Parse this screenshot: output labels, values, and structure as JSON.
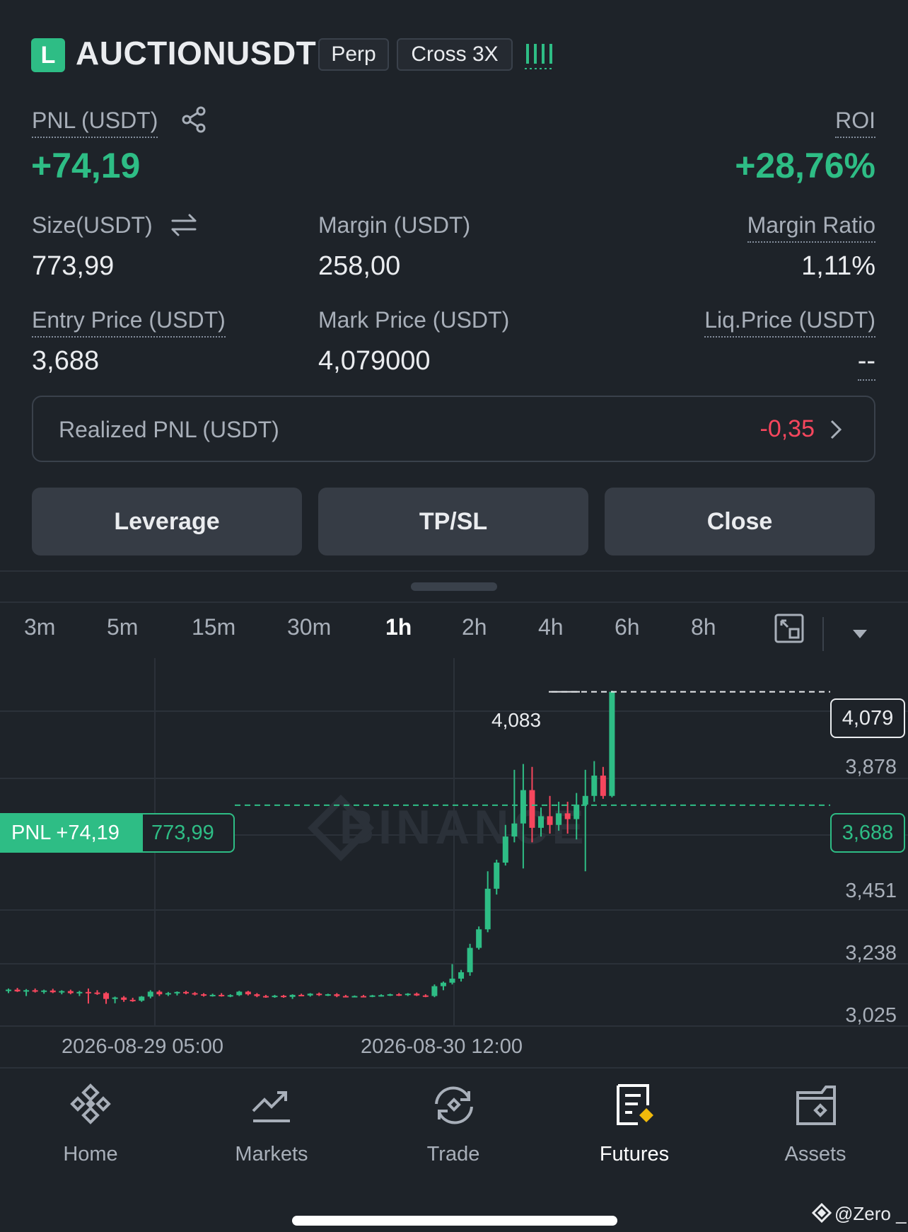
{
  "header": {
    "badge": "L",
    "symbol": "AUCTIONUSDT",
    "type_chip": "Perp",
    "margin_chip": "Cross 3X",
    "signal_icon": "signal-bars-icon"
  },
  "pnl": {
    "label": "PNL (USDT)",
    "value": "+74,19",
    "roi_label": "ROI",
    "roi_value": "+28,76%"
  },
  "stats": {
    "size_label": "Size(USDT)",
    "size_value": "773,99",
    "margin_label": "Margin (USDT)",
    "margin_value": "258,00",
    "ratio_label": "Margin Ratio",
    "ratio_value": "1,11%",
    "entry_label": "Entry Price (USDT)",
    "entry_value": "3,688",
    "mark_label": "Mark Price (USDT)",
    "mark_value": "4,079000",
    "liq_label": "Liq.Price (USDT)",
    "liq_value": "--"
  },
  "realized": {
    "label": "Realized PNL (USDT)",
    "value": "-0,35"
  },
  "actions": {
    "leverage": "Leverage",
    "tpsl": "TP/SL",
    "close": "Close"
  },
  "timeframes": [
    "3m",
    "5m",
    "15m",
    "30m",
    "1h",
    "2h",
    "4h",
    "6h",
    "8h"
  ],
  "active_timeframe": "1h",
  "chart": {
    "watermark": "BINANCE",
    "high_label": "4,083",
    "current_price": "4,079",
    "entry_price": "3,688",
    "pnl_tag": "PNL +74,19",
    "size_tag": "773,99",
    "y_ticks": [
      "3,878",
      "3,451",
      "3,238",
      "3,025"
    ],
    "x_ticks": [
      "2026-08-29 05:00",
      "2026-08-30 12:00"
    ]
  },
  "nav": {
    "home": "Home",
    "markets": "Markets",
    "trade": "Trade",
    "futures": "Futures",
    "assets": "Assets"
  },
  "credit": "@Zero _",
  "colors": {
    "up": "#2ebd85",
    "down": "#f6465d",
    "bg": "#1e2329"
  },
  "chart_data": {
    "type": "candlestick",
    "interval": "1h",
    "candles": [
      {
        "o": 3048,
        "h": 3056,
        "l": 3040,
        "c": 3052
      },
      {
        "o": 3052,
        "h": 3058,
        "l": 3044,
        "c": 3046
      },
      {
        "o": 3046,
        "h": 3054,
        "l": 3030,
        "c": 3050
      },
      {
        "o": 3050,
        "h": 3056,
        "l": 3042,
        "c": 3045
      },
      {
        "o": 3045,
        "h": 3052,
        "l": 3038,
        "c": 3049
      },
      {
        "o": 3049,
        "h": 3055,
        "l": 3040,
        "c": 3043
      },
      {
        "o": 3043,
        "h": 3050,
        "l": 3036,
        "c": 3047
      },
      {
        "o": 3047,
        "h": 3052,
        "l": 3036,
        "c": 3040
      },
      {
        "o": 3040,
        "h": 3048,
        "l": 3030,
        "c": 3044
      },
      {
        "o": 3044,
        "h": 3056,
        "l": 3004,
        "c": 3042
      },
      {
        "o": 3042,
        "h": 3050,
        "l": 3034,
        "c": 3038
      },
      {
        "o": 3040,
        "h": 3044,
        "l": 3003,
        "c": 3020
      },
      {
        "o": 3020,
        "h": 3028,
        "l": 3005,
        "c": 3025
      },
      {
        "o": 3025,
        "h": 3030,
        "l": 3010,
        "c": 3017
      },
      {
        "o": 3017,
        "h": 3024,
        "l": 3010,
        "c": 3014
      },
      {
        "o": 3014,
        "h": 3030,
        "l": 3010,
        "c": 3028
      },
      {
        "o": 3028,
        "h": 3050,
        "l": 3022,
        "c": 3045
      },
      {
        "o": 3045,
        "h": 3050,
        "l": 3030,
        "c": 3036
      },
      {
        "o": 3036,
        "h": 3044,
        "l": 3030,
        "c": 3040
      },
      {
        "o": 3040,
        "h": 3046,
        "l": 3032,
        "c": 3044
      },
      {
        "o": 3044,
        "h": 3048,
        "l": 3036,
        "c": 3040
      },
      {
        "o": 3040,
        "h": 3044,
        "l": 3032,
        "c": 3036
      },
      {
        "o": 3036,
        "h": 3040,
        "l": 3028,
        "c": 3032
      },
      {
        "o": 3032,
        "h": 3038,
        "l": 3028,
        "c": 3034
      },
      {
        "o": 3034,
        "h": 3040,
        "l": 3028,
        "c": 3030
      },
      {
        "o": 3030,
        "h": 3036,
        "l": 3026,
        "c": 3033
      },
      {
        "o": 3033,
        "h": 3048,
        "l": 3030,
        "c": 3045
      },
      {
        "o": 3045,
        "h": 3048,
        "l": 3032,
        "c": 3036
      },
      {
        "o": 3036,
        "h": 3040,
        "l": 3026,
        "c": 3030
      },
      {
        "o": 3030,
        "h": 3034,
        "l": 3024,
        "c": 3028
      },
      {
        "o": 3028,
        "h": 3034,
        "l": 3024,
        "c": 3031
      },
      {
        "o": 3031,
        "h": 3034,
        "l": 3024,
        "c": 3027
      },
      {
        "o": 3027,
        "h": 3036,
        "l": 3020,
        "c": 3034
      },
      {
        "o": 3034,
        "h": 3038,
        "l": 3030,
        "c": 3032
      },
      {
        "o": 3032,
        "h": 3040,
        "l": 3028,
        "c": 3038
      },
      {
        "o": 3038,
        "h": 3042,
        "l": 3030,
        "c": 3034
      },
      {
        "o": 3034,
        "h": 3038,
        "l": 3030,
        "c": 3036
      },
      {
        "o": 3036,
        "h": 3040,
        "l": 3026,
        "c": 3030
      },
      {
        "o": 3030,
        "h": 3034,
        "l": 3026,
        "c": 3029
      },
      {
        "o": 3029,
        "h": 3032,
        "l": 3026,
        "c": 3030
      },
      {
        "o": 3030,
        "h": 3034,
        "l": 3026,
        "c": 3028
      },
      {
        "o": 3028,
        "h": 3034,
        "l": 3026,
        "c": 3032
      },
      {
        "o": 3032,
        "h": 3036,
        "l": 3028,
        "c": 3033
      },
      {
        "o": 3033,
        "h": 3038,
        "l": 3030,
        "c": 3036
      },
      {
        "o": 3036,
        "h": 3040,
        "l": 3030,
        "c": 3034
      },
      {
        "o": 3034,
        "h": 3040,
        "l": 3030,
        "c": 3038
      },
      {
        "o": 3038,
        "h": 3042,
        "l": 3030,
        "c": 3032
      },
      {
        "o": 3032,
        "h": 3036,
        "l": 3026,
        "c": 3030
      },
      {
        "o": 3030,
        "h": 3070,
        "l": 3026,
        "c": 3064
      },
      {
        "o": 3064,
        "h": 3080,
        "l": 3050,
        "c": 3076
      },
      {
        "o": 3076,
        "h": 3140,
        "l": 3070,
        "c": 3090
      },
      {
        "o": 3090,
        "h": 3120,
        "l": 3080,
        "c": 3112
      },
      {
        "o": 3112,
        "h": 3210,
        "l": 3100,
        "c": 3196
      },
      {
        "o": 3196,
        "h": 3270,
        "l": 3190,
        "c": 3260
      },
      {
        "o": 3260,
        "h": 3460,
        "l": 3250,
        "c": 3400
      },
      {
        "o": 3400,
        "h": 3500,
        "l": 3380,
        "c": 3490
      },
      {
        "o": 3490,
        "h": 3620,
        "l": 3480,
        "c": 3580
      },
      {
        "o": 3580,
        "h": 3810,
        "l": 3560,
        "c": 3625
      },
      {
        "o": 3625,
        "h": 3830,
        "l": 3470,
        "c": 3740
      },
      {
        "o": 3740,
        "h": 3820,
        "l": 3560,
        "c": 3610
      },
      {
        "o": 3610,
        "h": 3680,
        "l": 3580,
        "c": 3650
      },
      {
        "o": 3650,
        "h": 3720,
        "l": 3590,
        "c": 3620
      },
      {
        "o": 3620,
        "h": 3700,
        "l": 3600,
        "c": 3660
      },
      {
        "o": 3660,
        "h": 3700,
        "l": 3590,
        "c": 3640
      },
      {
        "o": 3640,
        "h": 3730,
        "l": 3570,
        "c": 3690
      },
      {
        "o": 3690,
        "h": 3810,
        "l": 3460,
        "c": 3720
      },
      {
        "o": 3720,
        "h": 3840,
        "l": 3700,
        "c": 3790
      },
      {
        "o": 3790,
        "h": 3820,
        "l": 3710,
        "c": 3720
      },
      {
        "o": 3720,
        "h": 4083,
        "l": 3715,
        "c": 4079
      }
    ],
    "current_price": 4079,
    "entry_price": 3688,
    "y_ticks": [
      3025,
      3238,
      3451,
      3878
    ],
    "x_ticks": [
      "2026-08-29 05:00",
      "2026-08-30 12:00"
    ]
  }
}
